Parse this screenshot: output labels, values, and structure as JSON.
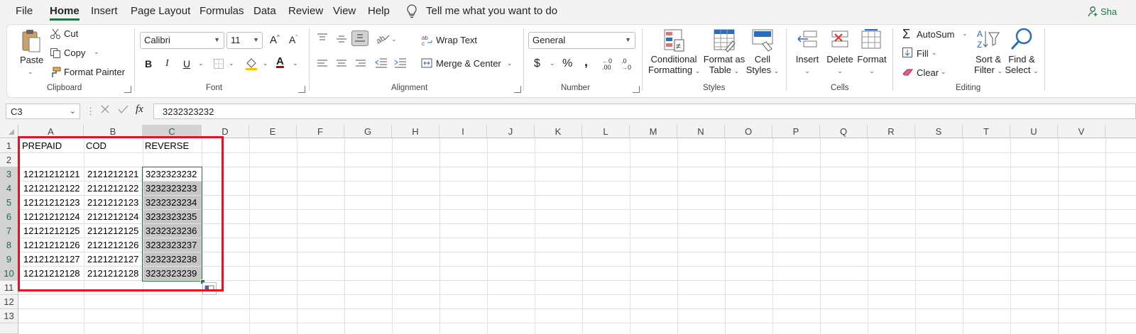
{
  "menu": {
    "items": [
      "File",
      "Home",
      "Insert",
      "Page Layout",
      "Formulas",
      "Data",
      "Review",
      "View",
      "Help"
    ],
    "active": "Home",
    "tell_me": "Tell me what you want to do",
    "share": "Sha"
  },
  "ribbon": {
    "clipboard": {
      "paste": "Paste",
      "cut": "Cut",
      "copy": "Copy",
      "format_painter": "Format Painter",
      "label": "Clipboard"
    },
    "font": {
      "name": "Calibri",
      "size": "11",
      "bold": "B",
      "italic": "I",
      "underline": "U",
      "grow": "A",
      "shrink": "A",
      "font_color": "A",
      "label": "Font"
    },
    "alignment": {
      "wrap_text": "Wrap Text",
      "merge_center": "Merge & Center",
      "label": "Alignment"
    },
    "number": {
      "format": "General",
      "currency": "$",
      "percent": "%",
      "comma": ",",
      "inc_decimal": ".00",
      "dec_decimal": ".0",
      "label": "Number"
    },
    "styles": {
      "conditional": "Conditional",
      "conditional2": "Formatting",
      "format_as": "Format as",
      "format_as2": "Table",
      "cell": "Cell",
      "cell2": "Styles",
      "label": "Styles"
    },
    "cells": {
      "insert": "Insert",
      "delete": "Delete",
      "format": "Format",
      "label": "Cells"
    },
    "editing": {
      "autosum": "AutoSum",
      "fill": "Fill",
      "clear": "Clear",
      "sort": "Sort &",
      "sort2": "Filter",
      "find": "Find &",
      "find2": "Select",
      "label": "Editing"
    }
  },
  "formula_bar": {
    "name_box": "C3",
    "fx": "fx",
    "value": "3232323232"
  },
  "columns": [
    "A",
    "B",
    "C",
    "D",
    "E",
    "F",
    "G",
    "H",
    "I",
    "J",
    "K",
    "L",
    "M",
    "N",
    "O",
    "P",
    "Q",
    "R",
    "S",
    "T",
    "U",
    "V"
  ],
  "rows": [
    "1",
    "2",
    "3",
    "4",
    "5",
    "6",
    "7",
    "8",
    "9",
    "10",
    "11",
    "12",
    "13"
  ],
  "cells": {
    "headers": [
      "PREPAID",
      "COD",
      "REVERSE"
    ],
    "data": [
      [
        "12121212121",
        "2121212121",
        "3232323232"
      ],
      [
        "12121212122",
        "2121212122",
        "3232323233"
      ],
      [
        "12121212123",
        "2121212123",
        "3232323234"
      ],
      [
        "12121212124",
        "2121212124",
        "3232323235"
      ],
      [
        "12121212125",
        "2121212125",
        "3232323236"
      ],
      [
        "12121212126",
        "2121212126",
        "3232323237"
      ],
      [
        "12121212127",
        "2121212127",
        "3232323238"
      ],
      [
        "12121212128",
        "2121212128",
        "3232323239"
      ]
    ]
  },
  "colors": {
    "accent": "#217346",
    "highlight_box": "#e81123",
    "selection_fill": "#c6c6c6"
  }
}
